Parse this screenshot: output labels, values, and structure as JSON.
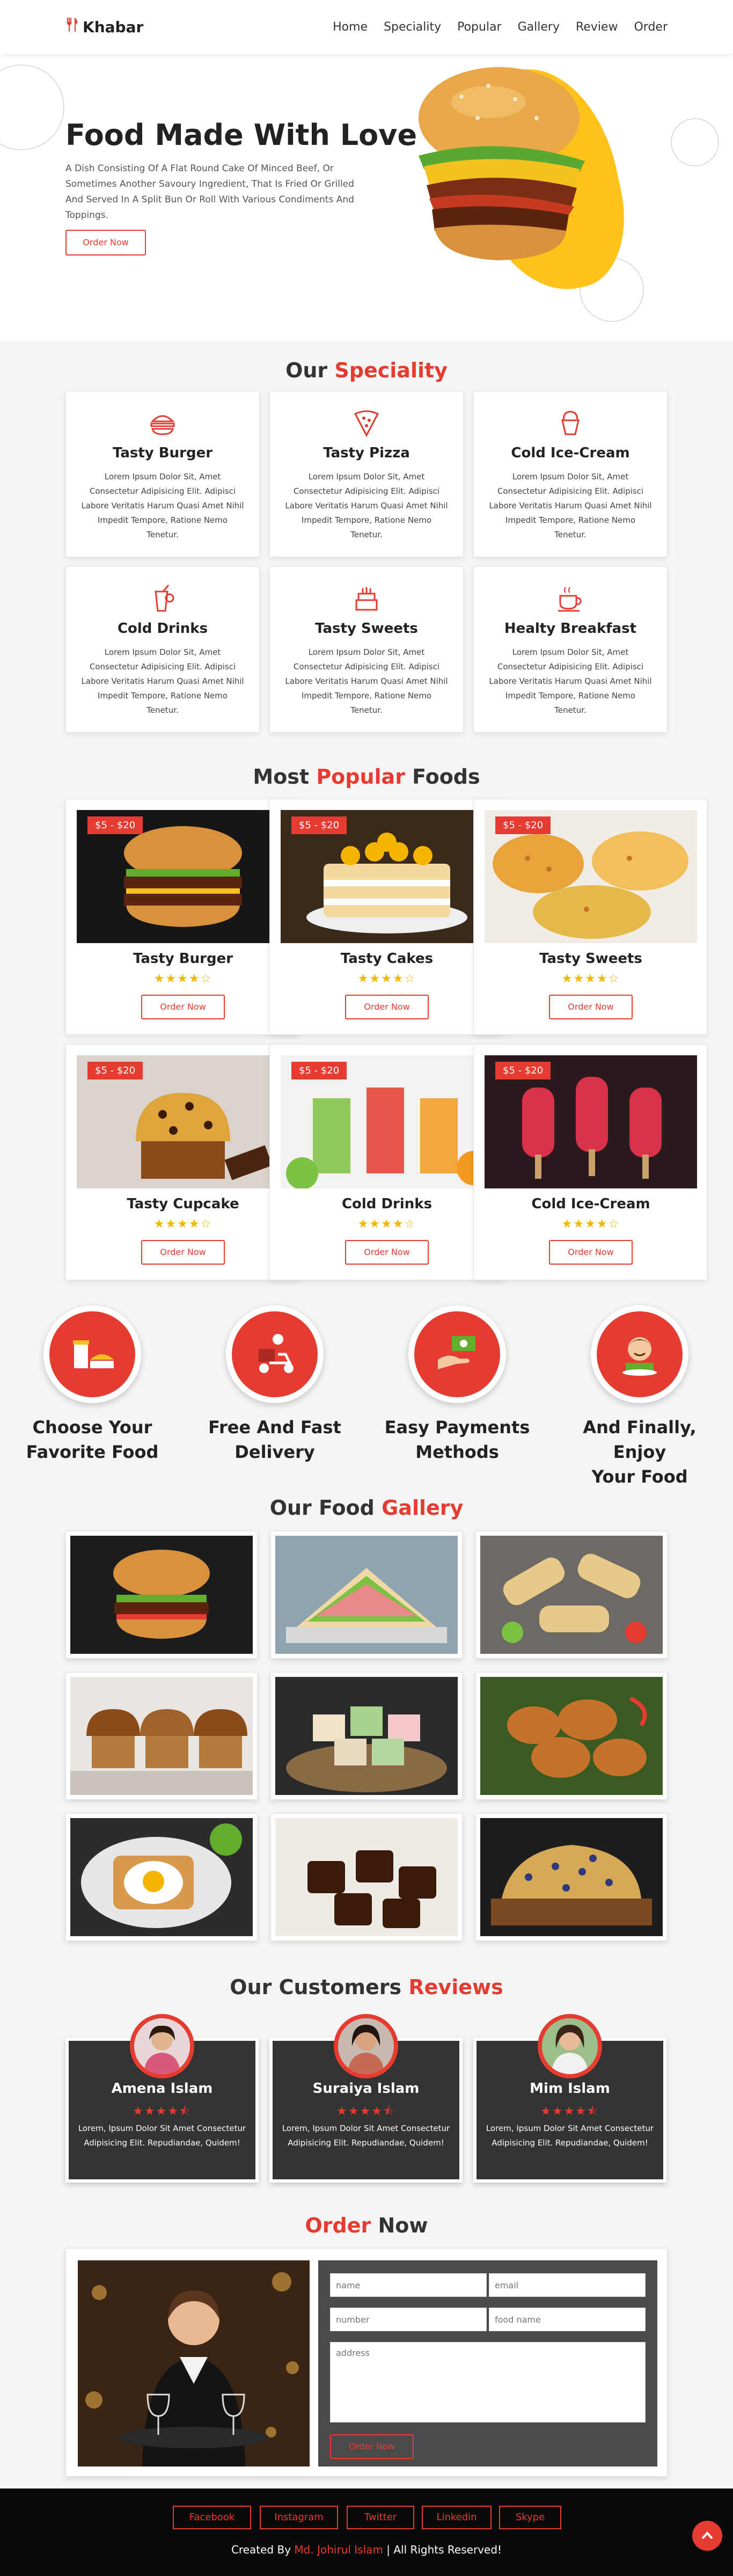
{
  "header": {
    "logo_text": "Khabar",
    "nav": [
      "Home",
      "Speciality",
      "Popular",
      "Gallery",
      "Review",
      "Order"
    ]
  },
  "hero": {
    "title": "Food Made With Love",
    "description": "A Dish Consisting Of A Flat Round Cake Of Minced Beef, Or Sometimes Another Savoury Ingredient, That Is Fried Or Grilled And Served In A Split Bun Or Roll With Various Condiments And Toppings.",
    "cta": "Order Now"
  },
  "speciality": {
    "title_a": "Our",
    "title_b": "Speciality",
    "items": [
      {
        "title": "Tasty Burger",
        "icon": "burger-icon",
        "text": "Lorem Ipsum Dolor Sit, Amet Consectetur Adipisicing Elit. Adipisci Labore Veritatis Harum Quasi Amet Nihil Impedit Tempore, Ratione Nemo Tenetur."
      },
      {
        "title": "Tasty Pizza",
        "icon": "pizza-icon",
        "text": "Lorem Ipsum Dolor Sit, Amet Consectetur Adipisicing Elit. Adipisci Labore Veritatis Harum Quasi Amet Nihil Impedit Tempore, Ratione Nemo Tenetur."
      },
      {
        "title": "Cold Ice-Cream",
        "icon": "ice-cream-icon",
        "text": "Lorem Ipsum Dolor Sit, Amet Consectetur Adipisicing Elit. Adipisci Labore Veritatis Harum Quasi Amet Nihil Impedit Tempore, Ratione Nemo Tenetur."
      },
      {
        "title": "Cold Drinks",
        "icon": "drink-icon",
        "text": "Lorem Ipsum Dolor Sit, Amet Consectetur Adipisicing Elit. Adipisci Labore Veritatis Harum Quasi Amet Nihil Impedit Tempore, Ratione Nemo Tenetur."
      },
      {
        "title": "Tasty Sweets",
        "icon": "cake-icon",
        "text": "Lorem Ipsum Dolor Sit, Amet Consectetur Adipisicing Elit. Adipisci Labore Veritatis Harum Quasi Amet Nihil Impedit Tempore, Ratione Nemo Tenetur."
      },
      {
        "title": "Healty Breakfast",
        "icon": "coffee-icon",
        "text": "Lorem Ipsum Dolor Sit, Amet Consectetur Adipisicing Elit. Adipisci Labore Veritatis Harum Quasi Amet Nihil Impedit Tempore, Ratione Nemo Tenetur."
      }
    ]
  },
  "popular": {
    "title_a": "Most",
    "title_b": "Popular",
    "title_c": "Foods",
    "items": [
      {
        "title": "Tasty Burger",
        "price": "$5 - $20",
        "rating": 4,
        "button": "Order Now"
      },
      {
        "title": "Tasty Cakes",
        "price": "$5 - $20",
        "rating": 4,
        "button": "Order Now"
      },
      {
        "title": "Tasty Sweets",
        "price": "$5 - $20",
        "rating": 4,
        "button": "Order Now"
      },
      {
        "title": "Tasty Cupcake",
        "price": "$5 - $20",
        "rating": 4,
        "button": "Order Now"
      },
      {
        "title": "Cold Drinks",
        "price": "$5 - $20",
        "rating": 4,
        "button": "Order Now"
      },
      {
        "title": "Cold Ice-Cream",
        "price": "$5 - $20",
        "rating": 4,
        "button": "Order Now"
      }
    ]
  },
  "steps": [
    {
      "line1": "Choose Your",
      "line2": "Favorite Food"
    },
    {
      "line1": "Free And Fast",
      "line2": "Delivery"
    },
    {
      "line1": "Easy Payments",
      "line2": "Methods"
    },
    {
      "line1": "And Finally, Enjoy",
      "line2": "Your Food"
    }
  ],
  "gallery": {
    "title_a": "Our Food",
    "title_b": "Gallery"
  },
  "reviews": {
    "title_a": "Our Customers",
    "title_b": "Reviews",
    "items": [
      {
        "name": "Amena Islam",
        "rating": 4.5,
        "text": "Lorem, Ipsum Dolor Sit Amet Consectetur Adipisicing Elit. Repudiandae, Quidem!"
      },
      {
        "name": "Suraiya Islam",
        "rating": 4.5,
        "text": "Lorem, Ipsum Dolor Sit Amet Consectetur Adipisicing Elit. Repudiandae, Quidem!"
      },
      {
        "name": "Mim Islam",
        "rating": 4.5,
        "text": "Lorem, Ipsum Dolor Sit Amet Consectetur Adipisicing Elit. Repudiandae, Quidem!"
      }
    ]
  },
  "order": {
    "title_a": "Order",
    "title_b": "Now",
    "placeholders": {
      "name": "name",
      "email": "email",
      "number": "number",
      "food": "food name",
      "address": "address"
    },
    "button": "Order Now"
  },
  "footer": {
    "social": [
      "Facebook",
      "Instagram",
      "Twitter",
      "Linkedin",
      "Skype"
    ],
    "credit_a": "Created By",
    "credit_name": "Md. Johirul Islam",
    "credit_b": "| All Rights Reserved!"
  },
  "colors": {
    "accent": "#e63b30",
    "star": "#f4b400",
    "dark": "#333333",
    "footer": "#0a0a0a"
  }
}
